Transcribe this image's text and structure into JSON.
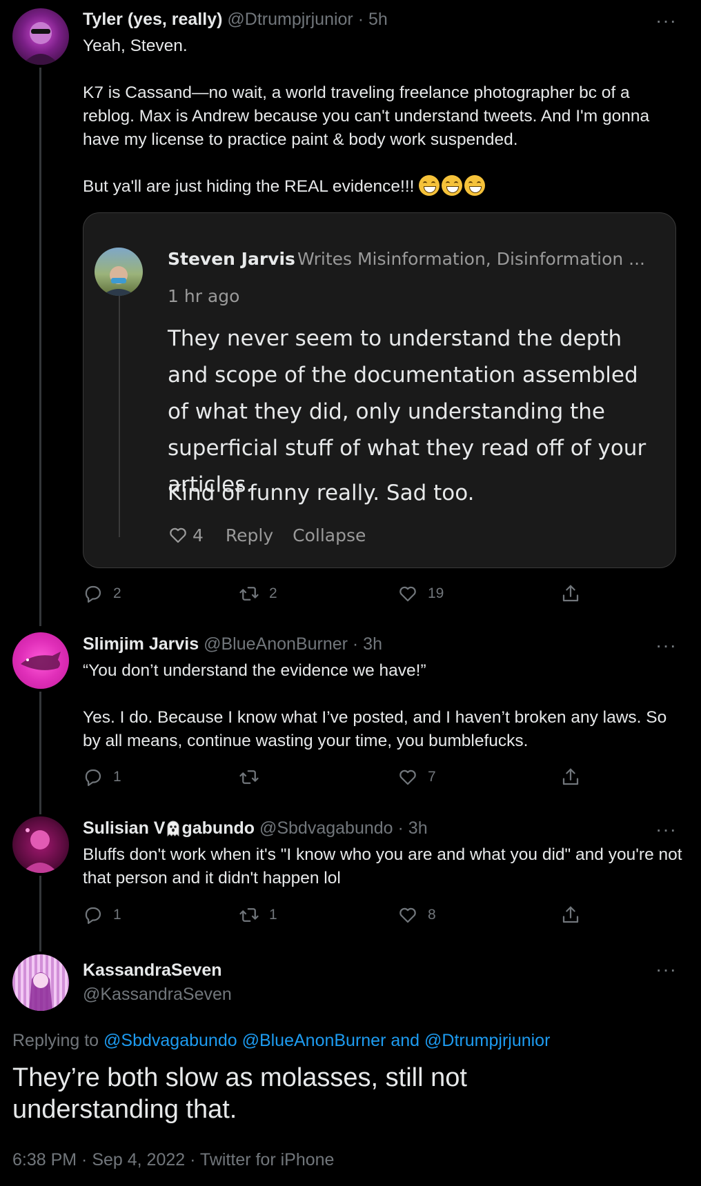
{
  "tweets": [
    {
      "name": "Tyler (yes, really)",
      "handle": "@Dtrumpjrjunior",
      "time": "· 5h",
      "para1": "Yeah, Steven.",
      "para2": "K7 is Cassand—no wait, a world traveling freelance photographer bc of a reblog. Max is Andrew because you can't understand tweets. And I'm gonna have my license to practice paint & body work suspended.",
      "para3": "But ya'll are just hiding the REAL evidence!!!",
      "replies": "2",
      "retweets": "2",
      "likes": "19",
      "embed": {
        "name": "Steven Jarvis",
        "bio": "Writes Misinformation, Disinformation ...",
        "time": "1 hr ago",
        "text": "They never seem to understand the depth and scope of the documentation assembled of what they did, only understanding the superficial stuff of what they read off of your articles.",
        "text2": "Kind of funny really. Sad too.",
        "likes": "4",
        "reply_label": "Reply",
        "collapse_label": "Collapse"
      }
    },
    {
      "name": "Slimjim Jarvis",
      "handle": "@BlueAnonBurner",
      "time": "· 3h",
      "para1": "“You don’t understand the evidence we have!”",
      "para2": "Yes. I do. Because I know what I’ve posted, and I haven’t broken any laws. So by all means, continue wasting your time, you bumblefucks.",
      "replies": "1",
      "retweets": "",
      "likes": "7"
    },
    {
      "name_a": "Sulisian V",
      "name_b": "gabundo",
      "handle": "@Sbdvagabundo",
      "time": "· 3h",
      "para1": "Bluffs don't work when it's \"I know who you are and what you did\" and you're not that person and it didn't happen lol",
      "replies": "1",
      "retweets": "1",
      "likes": "8"
    }
  ],
  "main": {
    "name": "KassandraSeven",
    "handle": "@KassandraSeven",
    "replying_prefix": "Replying to",
    "replying_to": [
      "@Sbdvagabundo",
      "@BlueAnonBurner",
      "and",
      "@Dtrumpjrjunior"
    ],
    "text": "They’re both slow as molasses, still not understanding that.",
    "footer": "6:38 PM · Sep 4, 2022 · Twitter for iPhone"
  },
  "more_label": "···",
  "colors": {
    "background": "#000000",
    "link": "#1d9bf0",
    "muted": "#71767b",
    "text": "#e7e9ea"
  }
}
